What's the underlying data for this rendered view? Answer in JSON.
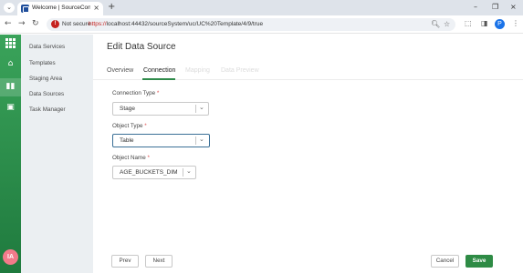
{
  "browser": {
    "tab_title": "Welcome | SourceConnect by ...",
    "security_label": "Not secure",
    "url_scheme": "https://",
    "url_rest": "localhost:44432/sourceSystem/uc/UC%20Template/4/9/true",
    "profile_initial": "P"
  },
  "sidebar": {
    "items": [
      {
        "label": "Data Services"
      },
      {
        "label": "Templates"
      },
      {
        "label": "Staging Area"
      },
      {
        "label": "Data Sources"
      },
      {
        "label": "Task Manager"
      }
    ]
  },
  "user": {
    "initials": "IA"
  },
  "page": {
    "title": "Edit Data Source"
  },
  "tabs": [
    {
      "label": "Overview"
    },
    {
      "label": "Connection"
    },
    {
      "label": "Mapping"
    },
    {
      "label": "Data Preview"
    }
  ],
  "form": {
    "connection_type": {
      "label": "Connection Type",
      "required": "*",
      "value": "Stage"
    },
    "object_type": {
      "label": "Object Type",
      "required": "*",
      "value": "Table"
    },
    "object_name": {
      "label": "Object Name",
      "required": "*",
      "value": "AGE_BUCKETS_DIM"
    }
  },
  "buttons": {
    "prev": "Prev",
    "next": "Next",
    "cancel": "Cancel",
    "save": "Save"
  },
  "colors": {
    "accent": "#2e8b45",
    "rail": "#2b8f4c",
    "required": "#e05050"
  }
}
